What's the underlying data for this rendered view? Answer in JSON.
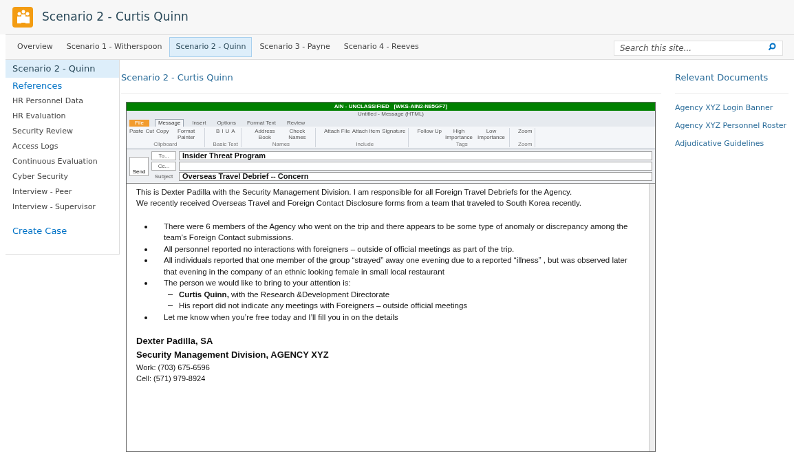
{
  "site": {
    "title": "Scenario 2 - Curtis Quinn"
  },
  "nav_tabs": [
    {
      "label": "Overview",
      "selected": false
    },
    {
      "label": "Scenario 1 - Witherspoon",
      "selected": false
    },
    {
      "label": "Scenario 2 - Quinn",
      "selected": true
    },
    {
      "label": "Scenario 3 - Payne",
      "selected": false
    },
    {
      "label": "Scenario 4 - Reeves",
      "selected": false
    }
  ],
  "search": {
    "placeholder": "Search this site..."
  },
  "left_nav": {
    "current": "Scenario 2 - Quinn",
    "heading": "References",
    "items": [
      "HR Personnel Data",
      "HR Evaluation",
      "Security Review",
      "Access Logs",
      "Continuous Evaluation",
      "Cyber Security",
      "Interview - Peer",
      "Interview - Supervisor"
    ],
    "action": "Create Case"
  },
  "page_title": "Scenario 2 - Curtis Quinn",
  "email": {
    "banner": "AIN - UNCLASSIFIED   [WKS-AIN2-N85GF7]",
    "window_title": "Untitled - Message (HTML)",
    "ribbon_tabs": [
      {
        "label": "File",
        "kind": "file",
        "selected": false
      },
      {
        "label": "Message",
        "kind": "tab",
        "selected": true
      },
      {
        "label": "Insert",
        "kind": "tab",
        "selected": false
      },
      {
        "label": "Options",
        "kind": "tab",
        "selected": false
      },
      {
        "label": "Format Text",
        "kind": "tab",
        "selected": false
      },
      {
        "label": "Review",
        "kind": "tab",
        "selected": false
      }
    ],
    "ribbon_groups": [
      {
        "label": "Clipboard",
        "buttons": [
          "Paste",
          "Cut",
          "Copy",
          "Format Painter"
        ]
      },
      {
        "label": "Basic Text",
        "buttons": [
          "B",
          "I",
          "U",
          "A"
        ]
      },
      {
        "label": "Names",
        "buttons": [
          "Address Book",
          "Check Names"
        ]
      },
      {
        "label": "Include",
        "buttons": [
          "Attach File",
          "Attach Item",
          "Signature"
        ]
      },
      {
        "label": "Tags",
        "buttons": [
          "Follow Up",
          "High Importance",
          "Low Importance"
        ]
      },
      {
        "label": "Zoom",
        "buttons": [
          "Zoom"
        ]
      }
    ],
    "send": "Send",
    "to_label": "To...",
    "cc_label": "Cc...",
    "subject_label": "Subject",
    "to": "Insider Threat Program",
    "subject": "Overseas Travel Debrief -- Concern",
    "intro": [
      "This is Dexter Padilla with the Security Management Division.  I am responsible for all Foreign Travel Debriefs for the Agency.",
      "We recently received Overseas Travel and Foreign Contact Disclosure forms from a team that traveled to South Korea recently."
    ],
    "bullets": [
      {
        "text": "There were 6 members of the Agency who went on the  trip and there appears to be some type of anomaly or discrepancy among the team’s Foreign Contact submissions."
      },
      {
        "text": "All personnel reported no interactions with foreigners – outside of official meetings as part of the trip."
      },
      {
        "text": "All individuals reported that one member of the group “strayed” away one evening due to a reported “illness” , but was observed  later that evening in the company of an ethnic looking female in small local restaurant"
      },
      {
        "text": "The person we would like to bring to your attention is:",
        "children": [
          "**Curtis Quinn,**  with the Research &Development  Directorate",
          "His report did not indicate any meetings with Foreigners – outside official meetings"
        ]
      },
      {
        "text": "Let me know when you’re free today and I’ll fill  you in on the details"
      }
    ],
    "signature": [
      "Dexter Padilla, SA",
      "Security Management Division, AGENCY XYZ",
      "Work: (703) 675-6596",
      "Cell: (571) 979-8924"
    ]
  },
  "relevant": {
    "heading": "Relevant Documents",
    "links": [
      "Agency XYZ Login Banner",
      "Agency XYZ Personnel Roster",
      "Adjudicative Guidelines"
    ]
  }
}
